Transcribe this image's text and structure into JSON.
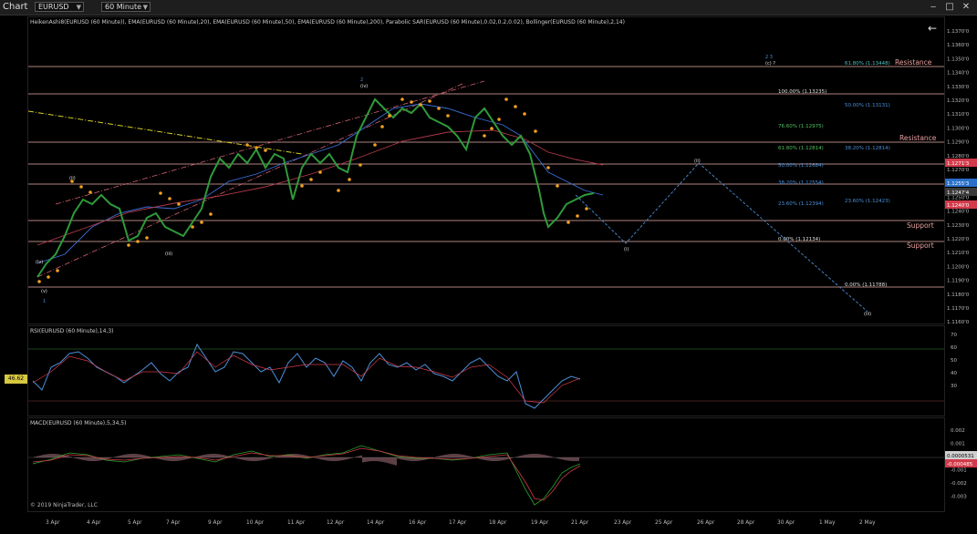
{
  "app": {
    "title": "Chart"
  },
  "toolbar": {
    "symbol": "EURUSD",
    "interval": "60 Minute"
  },
  "main_pane": {
    "indicators_label": "HeikenAshi8(EURUSD (60 Minute)), EMA(EURUSD (60 Minute),20), EMA(EURUSD (60 Minute),50), EMA(EURUSD (60 Minute),200), Parabolic SAR(EURUSD (60 Minute),0.02,0.2,0.02), Bollinger(EURUSD (60 Minute),2,14)",
    "price_ticks": [
      "1.1370'0",
      "1.1360'0",
      "1.1350'0",
      "1.1340'0",
      "1.1330'0",
      "1.1320'0",
      "1.1310'0",
      "1.1300'0",
      "1.1290'0",
      "1.1280'0",
      "1.1270'0",
      "1.1260'0",
      "1.1250'0",
      "1.1240'0",
      "1.1230'0",
      "1.1220'0",
      "1.1210'0",
      "1.1200'0",
      "1.1190'0",
      "1.1180'0",
      "1.1170'0",
      "1.1160'0"
    ],
    "price_badges": [
      {
        "label": "1.1271'3",
        "color": "#d23a4a"
      },
      {
        "label": "1.1255'3",
        "color": "#2a6fc9"
      },
      {
        "label": "1.1247'4",
        "color": "#3a3a3a"
      },
      {
        "label": "1.1240'0",
        "color": "#d23a4a"
      }
    ],
    "zone_labels": [
      "Resistance",
      "Resistance",
      "Support",
      "Support"
    ],
    "fib_left": [
      "100.00% (1.13235)",
      "76.60% (1.12975)",
      "61.80% (1.12814)",
      "50.00% (1.12684)",
      "38.20% (1.12554)",
      "23.60% (1.12394)",
      "0.00% (1.12134)"
    ],
    "fib_right": [
      "61.80% (1.13448)",
      "50.00% (1.13131)",
      "38.20% (1.12814)",
      "23.60% (1.12423)",
      "0.00% (1.11788)"
    ],
    "wave_labels": [
      "(iv)",
      "(v)",
      "1",
      "(ii)",
      "(iii)",
      "(iv)",
      "2",
      "(i)",
      "(ii)",
      "(iii)",
      "2 3",
      "(c) ?"
    ]
  },
  "rsi_pane": {
    "label": "RSI(EURUSD (60 Minute),14,3)",
    "ticks": [
      "70",
      "60",
      "50",
      "40",
      "30"
    ],
    "value_badge": "46.62",
    "chart_data": {
      "type": "line",
      "title": "RSI(EURUSD (60 Minute),14,3)",
      "ylim": [
        20,
        85
      ],
      "levels": [
        70,
        30
      ],
      "last": 46.62
    }
  },
  "macd_pane": {
    "label": "MACD(EURUSD (60 Minute),5,34,5)",
    "ticks": [
      "0.002",
      "0.001",
      "0",
      "-0.001",
      "-0.002",
      "-0.003"
    ],
    "badges": [
      {
        "label": "0.0000531",
        "color": "#cfcfcf"
      },
      {
        "label": "-0.000485",
        "color": "#d23a4a"
      }
    ]
  },
  "x_axis": {
    "dates": [
      "3 Apr",
      "4 Apr",
      "5 Apr",
      "7 Apr",
      "9 Apr",
      "10 Apr",
      "11 Apr",
      "12 Apr",
      "14 Apr",
      "16 Apr",
      "17 Apr",
      "18 Apr",
      "19 Apr",
      "21 Apr",
      "23 Apr",
      "25 Apr",
      "26 Apr",
      "28 Apr",
      "30 Apr",
      "1 May",
      "2 May"
    ]
  },
  "footer": {
    "copyright": "© 2019 NinjaTrader, LLC"
  },
  "colors": {
    "background": "#000000",
    "ema20": "#3b6fd8",
    "ema50": "#b23a4a",
    "sar": "#f0a020",
    "channel": "#d06070",
    "forecast": "#4a90d9",
    "fib": "#e0e0e0"
  }
}
